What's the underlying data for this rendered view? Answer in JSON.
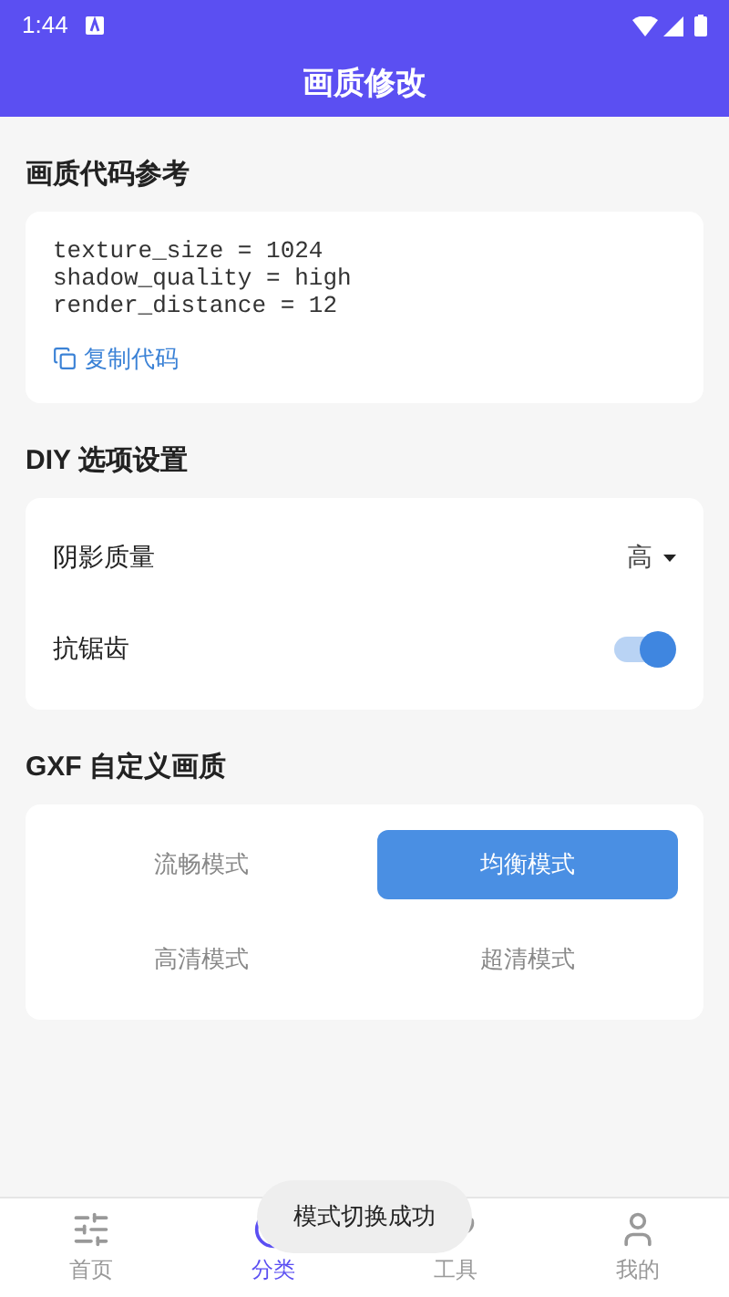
{
  "status_bar": {
    "time": "1:44"
  },
  "app_bar": {
    "title": "画质修改"
  },
  "code_section": {
    "title": "画质代码参考",
    "code_lines": [
      "texture_size = 1024",
      "shadow_quality = high",
      "render_distance = 12"
    ],
    "copy_link": "复制代码"
  },
  "diy_section": {
    "title": "DIY 选项设置",
    "options": [
      {
        "kind": "dropdown",
        "label": "阴影质量",
        "value": "高"
      },
      {
        "kind": "switch",
        "label": "抗锯齿",
        "on": true
      }
    ]
  },
  "gxf_section": {
    "title": "GXF 自定义画质",
    "modes": [
      {
        "label": "流畅模式",
        "selected": false
      },
      {
        "label": "均衡模式",
        "selected": true
      },
      {
        "label": "高清模式",
        "selected": false
      },
      {
        "label": "超清模式",
        "selected": false
      }
    ]
  },
  "bottom_nav": [
    {
      "label": "首页",
      "selected": false
    },
    {
      "label": "分类",
      "selected": true
    },
    {
      "label": "工具",
      "selected": false
    },
    {
      "label": "我的",
      "selected": false
    }
  ],
  "toast": "模式切换成功"
}
